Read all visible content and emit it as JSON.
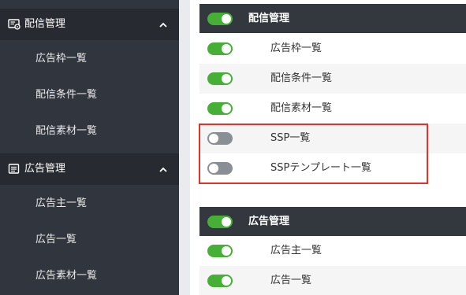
{
  "colors": {
    "sidebar_bg": "#31353d",
    "sidebar_group_bg": "#272b31",
    "toggle_on": "#45b035",
    "toggle_off": "#8a8e95",
    "highlight": "#e0342b"
  },
  "sidebar": {
    "groups": [
      {
        "label": "配信管理",
        "icon": "delivery-settings-icon",
        "expanded": true,
        "items": [
          {
            "label": "広告枠一覧"
          },
          {
            "label": "配信条件一覧"
          },
          {
            "label": "配信素材一覧"
          }
        ]
      },
      {
        "label": "広告管理",
        "icon": "ad-list-icon",
        "expanded": true,
        "items": [
          {
            "label": "広告主一覧"
          },
          {
            "label": "広告一覧"
          },
          {
            "label": "広告素材一覧"
          }
        ]
      }
    ]
  },
  "main": {
    "sections": [
      {
        "label": "配信管理",
        "enabled": true,
        "rows": [
          {
            "label": "広告枠一覧",
            "enabled": true
          },
          {
            "label": "配信条件一覧",
            "enabled": true
          },
          {
            "label": "配信素材一覧",
            "enabled": true
          },
          {
            "label": "SSP一覧",
            "enabled": false
          },
          {
            "label": "SSPテンプレート一覧",
            "enabled": false
          }
        ]
      },
      {
        "label": "広告管理",
        "enabled": true,
        "rows": [
          {
            "label": "広告主一覧",
            "enabled": true
          },
          {
            "label": "広告一覧",
            "enabled": true
          }
        ]
      }
    ]
  }
}
